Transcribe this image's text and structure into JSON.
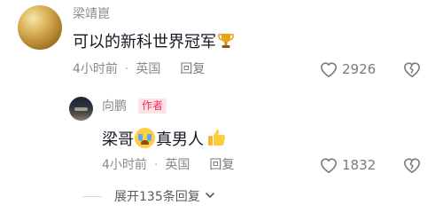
{
  "comment": {
    "username": "梁靖崑",
    "text": "可以的新科世界冠军",
    "time": "4小时前",
    "location": "英国",
    "reply_label": "回复",
    "likes": "2926"
  },
  "reply": {
    "username": "向鹏",
    "badge": "作者",
    "text_part1": "梁哥",
    "text_part2": "真男人",
    "time": "4小时前",
    "location": "英国",
    "reply_label": "回复",
    "likes": "1832"
  },
  "expand_label": "展开135条回复",
  "icons": {
    "trophy": "trophy-emoji",
    "crying": "loudly-crying-face-emoji",
    "thumbs_up": "thumbs-up-emoji",
    "like": "heart-outline-icon",
    "dislike": "broken-heart-outline-icon",
    "chevron": "chevron-down-icon"
  },
  "colors": {
    "author_badge_text": "#fe2c55",
    "author_badge_bg": "#fde3e8",
    "meta_text": "#8a8a8a",
    "comment_text": "#161823"
  }
}
